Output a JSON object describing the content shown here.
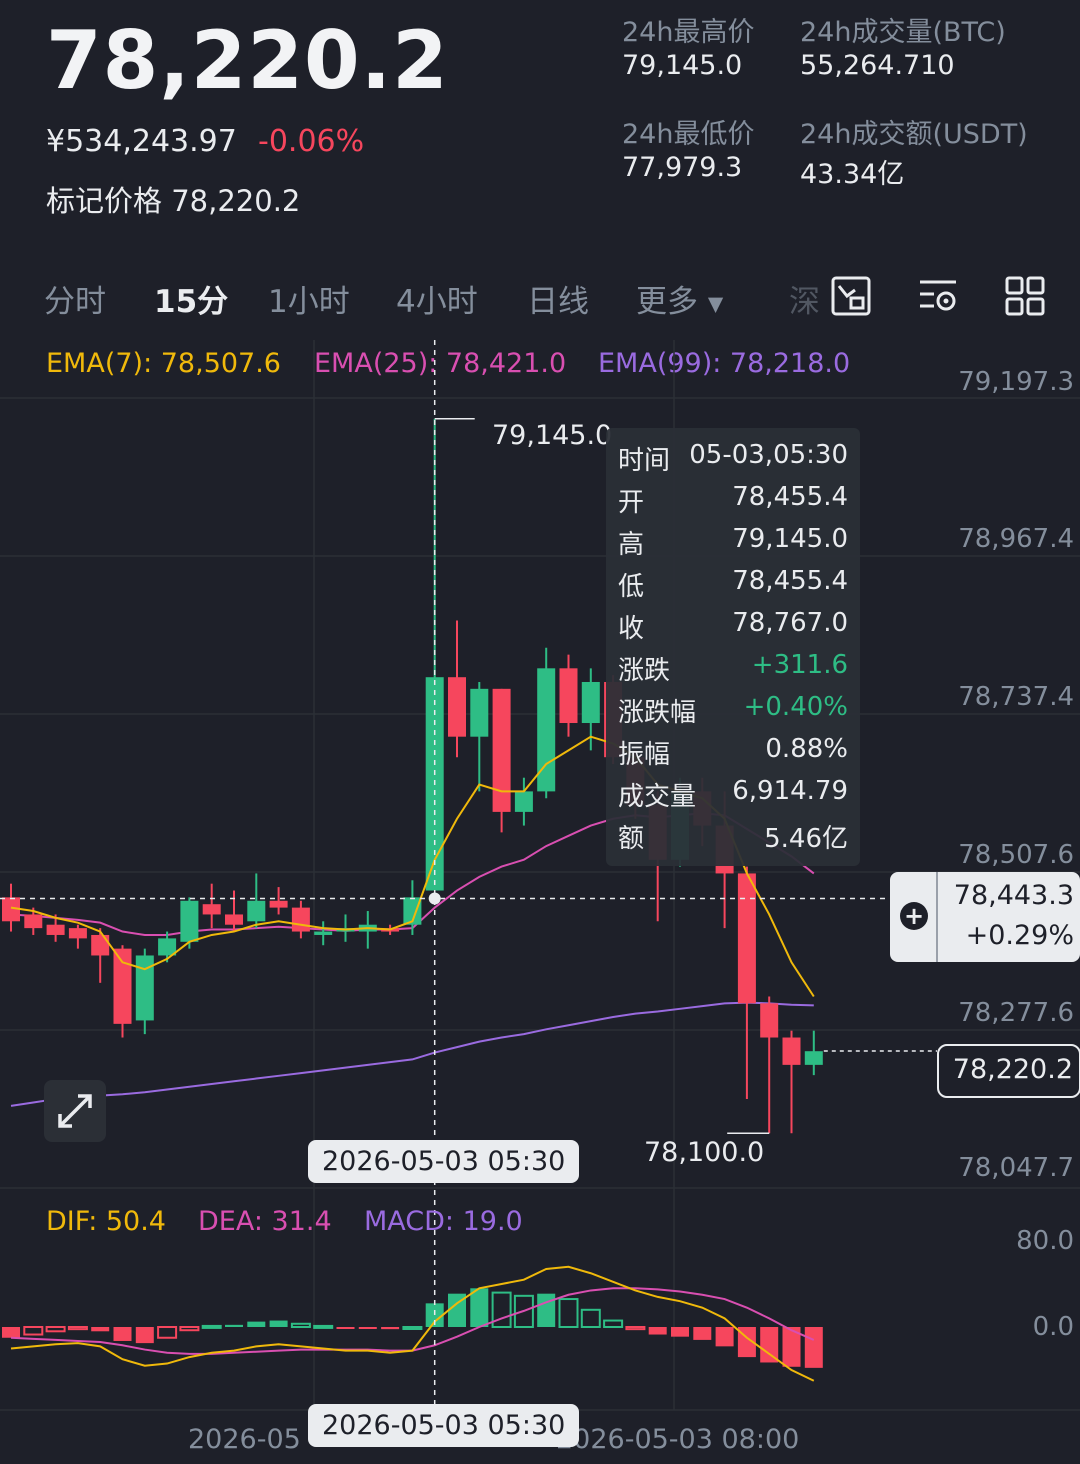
{
  "ticker": {
    "last_price": "78,220.2",
    "cny_price": "¥534,243.97",
    "change_pct": "-0.06%",
    "mark_label": "标记价格",
    "mark_price": "78,220.2",
    "stats": [
      {
        "label": "24h最高价",
        "value": "79,145.0"
      },
      {
        "label": "24h成交量(BTC)",
        "value": "55,264.710"
      },
      {
        "label": "24h最低价",
        "value": "77,979.3"
      },
      {
        "label": "24h成交额(USDT)",
        "value": "43.34亿"
      }
    ]
  },
  "tabs": [
    {
      "label": "分时",
      "active": false
    },
    {
      "label": "15分",
      "active": true
    },
    {
      "label": "1小时",
      "active": false
    },
    {
      "label": "4小时",
      "active": false
    },
    {
      "label": "日线",
      "active": false
    },
    {
      "label": "更多",
      "active": false
    },
    {
      "label": "深",
      "active": false
    }
  ],
  "toolbar_icons": [
    "chart-type-icon",
    "indicator-settings-icon",
    "layout-grid-icon"
  ],
  "ema": [
    {
      "label": "EMA(7): 78,507.6",
      "color": "#f0b90b"
    },
    {
      "label": "EMA(25): 78,421.0",
      "color": "#d94fb1"
    },
    {
      "label": "EMA(99): 78,218.0",
      "color": "#9a6be0"
    }
  ],
  "price_axis": [
    "79,197.3",
    "78,967.4",
    "78,737.4",
    "78,507.6",
    "78,277.6",
    "78,047.7"
  ],
  "high_marker": "79,145.0",
  "low_marker": "78,100.0",
  "crosshair": {
    "price": "78,443.3",
    "pct": "+0.29%",
    "time_label": "2026-05-03 05:30"
  },
  "last_price_tag": "78,220.2",
  "tooltip": [
    {
      "k": "时间",
      "v": "05-03,05:30",
      "color": "#eaecef"
    },
    {
      "k": "开",
      "v": "78,455.4",
      "color": "#eaecef"
    },
    {
      "k": "高",
      "v": "79,145.0",
      "color": "#eaecef"
    },
    {
      "k": "低",
      "v": "78,455.4",
      "color": "#eaecef"
    },
    {
      "k": "收",
      "v": "78,767.0",
      "color": "#eaecef"
    },
    {
      "k": "涨跌",
      "v": "+311.6",
      "color": "#2ebd85"
    },
    {
      "k": "涨跌幅",
      "v": "+0.40%",
      "color": "#2ebd85"
    },
    {
      "k": "振幅",
      "v": "0.88%",
      "color": "#eaecef"
    },
    {
      "k": "成交量",
      "v": "6,914.79",
      "color": "#eaecef"
    },
    {
      "k": "额",
      "v": "5.46亿",
      "color": "#eaecef"
    }
  ],
  "macd": {
    "dif": "DIF: 50.4",
    "dea": "DEA: 31.4",
    "macd": "MACD: 19.0",
    "axis": [
      "80.0",
      "0.0"
    ]
  },
  "time_axis": [
    "2026-05",
    "2026-05-03 08:00"
  ],
  "colors": {
    "up": "#2ebd85",
    "down": "#f6465d",
    "ema7": "#f0b90b",
    "ema25": "#d94fb1",
    "ema99": "#9a6be0"
  },
  "chart_data": {
    "type": "candlestick",
    "interval": "15m",
    "ylim": [
      78047.7,
      79197.3
    ],
    "candles": [
      {
        "o": 78445,
        "h": 78465,
        "l": 78395,
        "c": 78410
      },
      {
        "o": 78420,
        "h": 78430,
        "l": 78390,
        "c": 78400
      },
      {
        "o": 78405,
        "h": 78420,
        "l": 78380,
        "c": 78390
      },
      {
        "o": 78400,
        "h": 78405,
        "l": 78370,
        "c": 78385
      },
      {
        "o": 78390,
        "h": 78400,
        "l": 78320,
        "c": 78360
      },
      {
        "o": 78370,
        "h": 78375,
        "l": 78240,
        "c": 78260
      },
      {
        "o": 78265,
        "h": 78370,
        "l": 78245,
        "c": 78360
      },
      {
        "o": 78360,
        "h": 78395,
        "l": 78350,
        "c": 78385
      },
      {
        "o": 78380,
        "h": 78445,
        "l": 78370,
        "c": 78440
      },
      {
        "o": 78435,
        "h": 78465,
        "l": 78400,
        "c": 78420
      },
      {
        "o": 78420,
        "h": 78455,
        "l": 78395,
        "c": 78405
      },
      {
        "o": 78410,
        "h": 78480,
        "l": 78400,
        "c": 78440
      },
      {
        "o": 78440,
        "h": 78460,
        "l": 78420,
        "c": 78430
      },
      {
        "o": 78430,
        "h": 78440,
        "l": 78385,
        "c": 78395
      },
      {
        "o": 78390,
        "h": 78410,
        "l": 78375,
        "c": 78395
      },
      {
        "o": 78395,
        "h": 78420,
        "l": 78380,
        "c": 78400
      },
      {
        "o": 78395,
        "h": 78425,
        "l": 78370,
        "c": 78405
      },
      {
        "o": 78400,
        "h": 78405,
        "l": 78390,
        "c": 78395
      },
      {
        "o": 78405,
        "h": 78470,
        "l": 78390,
        "c": 78445
      },
      {
        "o": 78455,
        "h": 79145,
        "l": 78455,
        "c": 78767
      },
      {
        "o": 78767,
        "h": 78850,
        "l": 78650,
        "c": 78680
      },
      {
        "o": 78680,
        "h": 78760,
        "l": 78600,
        "c": 78750
      },
      {
        "o": 78750,
        "h": 78750,
        "l": 78540,
        "c": 78570
      },
      {
        "o": 78570,
        "h": 78620,
        "l": 78550,
        "c": 78600
      },
      {
        "o": 78600,
        "h": 78810,
        "l": 78590,
        "c": 78780
      },
      {
        "o": 78780,
        "h": 78800,
        "l": 78680,
        "c": 78700
      },
      {
        "o": 78700,
        "h": 78780,
        "l": 78660,
        "c": 78760
      },
      {
        "o": 78760,
        "h": 78770,
        "l": 78640,
        "c": 78650
      },
      {
        "o": 78650,
        "h": 78660,
        "l": 78560,
        "c": 78580
      },
      {
        "o": 78580,
        "h": 78600,
        "l": 78410,
        "c": 78500
      },
      {
        "o": 78500,
        "h": 78620,
        "l": 78490,
        "c": 78600
      },
      {
        "o": 78600,
        "h": 78620,
        "l": 78520,
        "c": 78550
      },
      {
        "o": 78550,
        "h": 78600,
        "l": 78400,
        "c": 78480
      },
      {
        "o": 78480,
        "h": 78490,
        "l": 78150,
        "c": 78290
      },
      {
        "o": 78290,
        "h": 78300,
        "l": 78100,
        "c": 78240
      },
      {
        "o": 78240,
        "h": 78250,
        "l": 78100,
        "c": 78200
      },
      {
        "o": 78200,
        "h": 78250,
        "l": 78185,
        "c": 78220
      }
    ],
    "ema7": [
      78430,
      78425,
      78415,
      78408,
      78395,
      78350,
      78340,
      78355,
      78380,
      78390,
      78395,
      78405,
      78410,
      78405,
      78400,
      78398,
      78400,
      78398,
      78410,
      78500,
      78560,
      78610,
      78600,
      78600,
      78640,
      78660,
      78680,
      78670,
      78650,
      78610,
      78600,
      78590,
      78560,
      78480,
      78420,
      78350,
      78300
    ],
    "ema25": [
      78420,
      78418,
      78415,
      78412,
      78408,
      78395,
      78390,
      78390,
      78395,
      78398,
      78398,
      78400,
      78402,
      78400,
      78398,
      78396,
      78398,
      78398,
      78400,
      78430,
      78455,
      78475,
      78490,
      78500,
      78520,
      78535,
      78550,
      78560,
      78565,
      78562,
      78565,
      78568,
      78565,
      78545,
      78525,
      78505,
      78480
    ],
    "ema99": [
      78140,
      78145,
      78150,
      78153,
      78155,
      78157,
      78160,
      78164,
      78168,
      78172,
      78176,
      78180,
      78184,
      78188,
      78192,
      78196,
      78200,
      78204,
      78208,
      78218,
      78226,
      78234,
      78240,
      78245,
      78252,
      78258,
      78264,
      78270,
      78275,
      78278,
      78282,
      78286,
      78290,
      78291,
      78290,
      78288,
      78287
    ],
    "macd_dif": [
      -20,
      -18,
      -16,
      -15,
      -18,
      -30,
      -36,
      -34,
      -28,
      -24,
      -22,
      -18,
      -16,
      -18,
      -20,
      -22,
      -22,
      -24,
      -22,
      5,
      22,
      36,
      40,
      44,
      54,
      56,
      50,
      42,
      34,
      28,
      24,
      18,
      8,
      -10,
      -25,
      -40,
      -50
    ],
    "macd_dea": [
      -10,
      -11,
      -12,
      -13,
      -14,
      -17,
      -21,
      -24,
      -25,
      -25,
      -24,
      -23,
      -22,
      -21,
      -21,
      -21,
      -21,
      -22,
      -22,
      -17,
      -9,
      0,
      8,
      15,
      23,
      30,
      34,
      36,
      36,
      35,
      33,
      30,
      26,
      18,
      8,
      -3,
      -12
    ]
  }
}
